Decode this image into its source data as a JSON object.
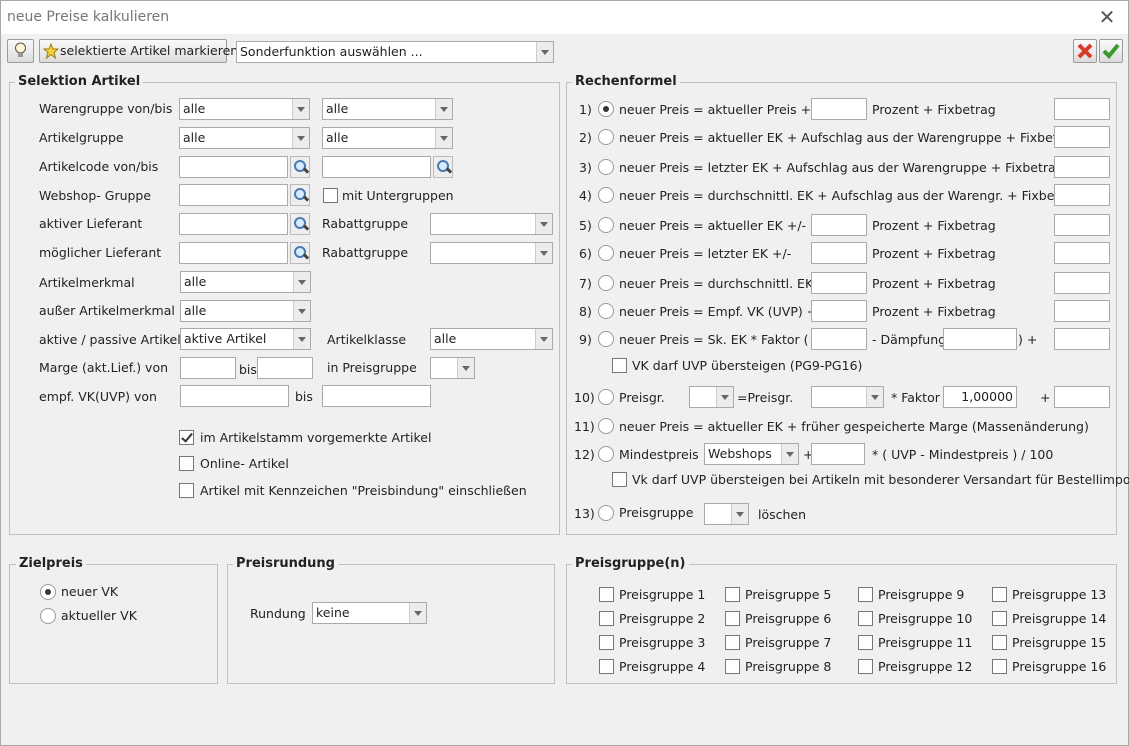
{
  "window": {
    "title": "neue Preise kalkulieren"
  },
  "toolbar": {
    "mark_label": "selektierte Artikel markieren",
    "special_select": "Sonderfunktion auswählen ..."
  },
  "selektion": {
    "title": "Selektion Artikel",
    "rows": [
      {
        "label": "Warengruppe von/bis",
        "from": "alle",
        "to": "alle"
      },
      {
        "label": "Artikelgruppe",
        "from": "alle",
        "to": "alle"
      },
      {
        "label": "Artikelcode von/bis"
      },
      {
        "label": "Webshop- Gruppe",
        "check": "mit Untergruppen"
      },
      {
        "label": "aktiver Lieferant",
        "sub": "Rabattgruppe"
      },
      {
        "label": "möglicher Lieferant",
        "sub": "Rabattgruppe"
      },
      {
        "label": "Artikelmerkmal",
        "value": "alle"
      },
      {
        "label": "außer Artikelmerkmal",
        "value": "alle"
      },
      {
        "label": "aktive / passive Artikel",
        "value": "aktive Artikel",
        "sub": "Artikelklasse",
        "subvalue": "alle"
      },
      {
        "label": "Marge (akt.Lief.) von",
        "bis": "bis",
        "sub": "in Preisgruppe"
      },
      {
        "label": "empf. VK(UVP) von",
        "bis": "bis"
      }
    ],
    "checks": [
      {
        "label": "im Artikelstamm vorgemerkte Artikel",
        "checked": true
      },
      {
        "label": "Online- Artikel",
        "checked": false
      },
      {
        "label": "Artikel mit Kennzeichen \"Preisbindung\" einschließen",
        "checked": false
      }
    ]
  },
  "rechen": {
    "title": "Rechenformel",
    "rows": [
      {
        "num": "1)",
        "text": "neuer Preis = aktueller Preis +/-",
        "suffix": "Prozent  + Fixbetrag",
        "selected": true
      },
      {
        "num": "2)",
        "text": "neuer Preis = aktueller EK + Aufschlag aus der Warengruppe + Fixbetrag"
      },
      {
        "num": "3)",
        "text": "neuer Preis = letzter EK + Aufschlag aus der Warengruppe + Fixbetrag"
      },
      {
        "num": "4)",
        "text": "neuer Preis = durchschnittl. EK + Aufschlag aus der Warengr. + Fixbetrag"
      },
      {
        "num": "5)",
        "text": "neuer Preis = aktueller EK +/-",
        "suffix": "Prozent + Fixbetrag"
      },
      {
        "num": "6)",
        "text": "neuer Preis = letzter EK +/-",
        "suffix": "Prozent + Fixbetrag"
      },
      {
        "num": "7)",
        "text": "neuer Preis = durchschnittl. EK +/-",
        "suffix": "Prozent + Fixbetrag"
      },
      {
        "num": "8)",
        "text": "neuer Preis = Empf. VK (UVP) +/-",
        "suffix": "Prozent + Fixbetrag"
      },
      {
        "num": "9)",
        "text": "neuer Preis = Sk. EK * Faktor (",
        "mid": "- Dämpfung",
        "end": ") +"
      }
    ],
    "r9_check": "VK darf UVP übersteigen (PG9-PG16)",
    "r10": {
      "num": "10)",
      "a": "Preisgr.",
      "b": "=Preisgr.",
      "c": "* Faktor",
      "factor": "1,00000",
      "plus": "+"
    },
    "r11": {
      "num": "11)",
      "text": "neuer Preis = aktueller EK + früher gespeicherte Marge (Massenänderung)"
    },
    "r12": {
      "num": "12)",
      "a": "Mindestpreis",
      "select": "Webshops",
      "plus": "+",
      "formula": "* ( UVP - Mindestpreis ) / 100",
      "check": "Vk darf UVP übersteigen bei Artikeln mit besonderer Versandart für Bestellimport"
    },
    "r13": {
      "num": "13)",
      "a": "Preisgruppe",
      "b": "löschen"
    }
  },
  "ziel": {
    "title": "Zielpreis",
    "options": [
      "neuer VK",
      "aktueller VK"
    ]
  },
  "rundung": {
    "title": "Preisrundung",
    "label": "Rundung",
    "value": "keine"
  },
  "preisgruppen": {
    "title": "Preisgruppe(n)",
    "items": [
      "Preisgruppe 1",
      "Preisgruppe 2",
      "Preisgruppe 3",
      "Preisgruppe 4",
      "Preisgruppe 5",
      "Preisgruppe 6",
      "Preisgruppe 7",
      "Preisgruppe 8",
      "Preisgruppe 9",
      "Preisgruppe 10",
      "Preisgruppe 11",
      "Preisgruppe 12",
      "Preisgruppe 13",
      "Preisgruppe 14",
      "Preisgruppe 15",
      "Preisgruppe 16"
    ]
  },
  "colors": {
    "accent": "#4a78b0",
    "cancel": "#d83a2c",
    "ok": "#3a9a2c"
  },
  "icons": {
    "hint": "lightbulb-icon",
    "mark": "star-icon",
    "cancel": "cancel-x-icon",
    "ok": "checkmark-icon",
    "search": "magnifier-icon",
    "close": "close-icon"
  }
}
